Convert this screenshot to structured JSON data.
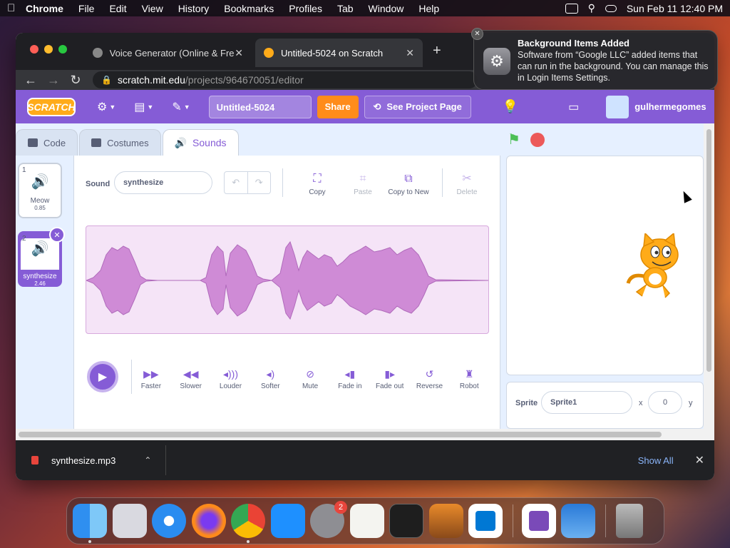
{
  "menubar": {
    "app": "Chrome",
    "items": [
      "File",
      "Edit",
      "View",
      "History",
      "Bookmarks",
      "Profiles",
      "Tab",
      "Window",
      "Help"
    ],
    "clock": "Sun Feb 11  12:40 PM"
  },
  "browser": {
    "tabs": [
      {
        "title": "Voice Generator (Online & Free",
        "active": false
      },
      {
        "title": "Untitled-5024 on Scratch",
        "active": true
      }
    ],
    "url_host": "scratch.mit.edu",
    "url_path": "/projects/964670051/editor"
  },
  "scratch": {
    "logo": "SCRATCH",
    "project_title": "Untitled-5024",
    "share": "Share",
    "see_project": "See Project Page",
    "username": "gulhermegomes",
    "tabs": [
      "Code",
      "Costumes",
      "Sounds"
    ],
    "active_tab": "Sounds",
    "sounds": [
      {
        "index": "1",
        "name": "Meow",
        "duration": "0.85"
      },
      {
        "index": "2",
        "name": "synthesize",
        "duration": "2.46"
      }
    ],
    "sound_label": "Sound",
    "sound_name": "synthesize",
    "tools": [
      "Copy",
      "Paste",
      "Copy to New",
      "Delete"
    ],
    "effects": [
      "Faster",
      "Slower",
      "Louder",
      "Softer",
      "Mute",
      "Fade in",
      "Fade out",
      "Reverse",
      "Robot"
    ],
    "sprite_label": "Sprite",
    "sprite_name": "Sprite1",
    "x_label": "x",
    "x_value": "0",
    "y_label": "y"
  },
  "download": {
    "filename": "synthesize.mp3",
    "show_all": "Show All"
  },
  "notification": {
    "title": "Background Items Added",
    "body": "Software from “Google LLC” added items that can run in the background. You can manage this in Login Items Settings."
  },
  "dock": {
    "apps": [
      "finder-icon",
      "launchpad-icon",
      "safari-icon",
      "firefox-icon",
      "chrome-icon",
      "app-store-icon",
      "system-settings-icon",
      "textedit-icon",
      "terminal-icon",
      "garageband-icon",
      "vscode-icon",
      "visual-studio-icon",
      "weather-icon",
      "trash-icon"
    ],
    "settings_badge": "2"
  }
}
